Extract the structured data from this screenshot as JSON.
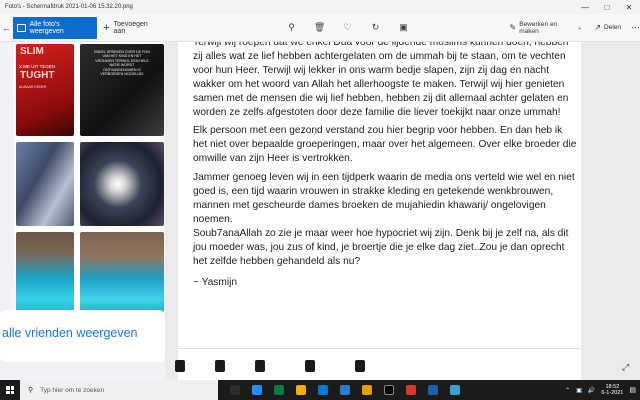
{
  "window": {
    "title": "Foto's - Schermafdruk 2021-01-06 15.32.20.png",
    "controls": [
      "minimize-icon",
      "maximize-icon",
      "close-icon"
    ]
  },
  "toolbar": {
    "all_photos_label": "Alle foto's weergeven",
    "add_label": "Toevoegen aan",
    "tool_icons": [
      "zoom-icon",
      "delete-icon",
      "favorite-icon",
      "rotate-icon",
      "crop-icon"
    ],
    "edit_label": "Bewerken en maken",
    "share_label": "Delen",
    "more_icon": "more-icon"
  },
  "left_panel": {
    "thumb1_line1": "SLIM",
    "thumb1_line2": "X ME UIT TEGEN",
    "thumb1_line3": "TUGHT",
    "thumb1_line4": "ALWAAR EEDER",
    "thumb2_text": "ENKEL SPREKEN OVER DE PIJN VAN HET KIND EN HET VROUWEN TERWIJL EEN HELE NATIE WORDT ONTVANGENOMEN IS VERBORGEN MOGELIJK!",
    "friends_label": "alle vrienden weergeven"
  },
  "post": {
    "paragraphs": [
      "Terwijl wij roepen dat we enkel Dua voor de lijdende moslims kunnen doen, hebben zij alles wat ze lief hebben achtergelaten om de ummah bij te staan, om te vechten voor hun Heer. Terwijl wij lekker in ons warm bedje slapen, zijn zij dag en nacht wakker om het woord van Allah het allerhoogste te maken. Terwijl wij hier genieten samen met de mensen die wij lief hebben, hebben zij dit allemaal achter gelaten en worden ze zelfs afgestoten door deze familie die liever toekijkt naar onze ummah!",
      "Elk persoon met een gezond verstand zou hier begrip voor hebben. En dan heb ik het niet over bepaalde groeperingen, maar over het algemeen. Over elke broeder die omwille van zijn Heer is vertrokken.",
      "Jammer genoeg leven wij in een tijdperk waarin de media ons verteld wie wel en niet goed is, een tijd waarin vrouwen in strakke kleding en getekende wenkbrouwen, mannen met gescheurde dames broeken de mujahiedin khawarij/ ongelovigen noemen.",
      "Soub7anaAllah zo zie je maar weer hoe hypocriet wij zijn. Denk bij je zelf na, als dit jou moeder was, jou zus of kind, je broertje die je elke dag ziet..Zou je dan oprecht het zelfde hebben gehandeld als nu?",
      "~ Yasmijn"
    ]
  },
  "taskbar": {
    "search_placeholder": "Typ hier om te zoeken",
    "app_colors": [
      "#2d2d2d",
      "#1e90ff",
      "#0b7a3b",
      "#f3b000",
      "#0078d4",
      "#2b7cd3",
      "#e8a000",
      "#000000",
      "#d63a2a",
      "#1f5fa8",
      "#3aa0d8"
    ],
    "time": "18:52",
    "date": "6-1-2021"
  }
}
